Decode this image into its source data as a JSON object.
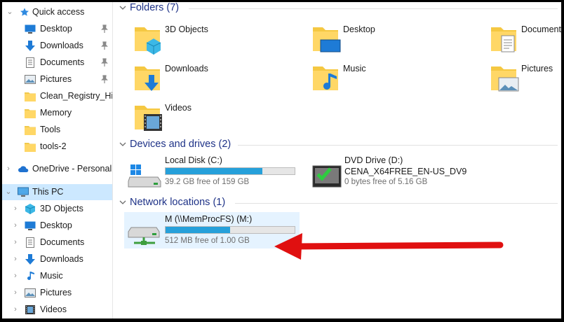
{
  "sidebar": {
    "quick_access": {
      "label": "Quick access",
      "items": [
        {
          "label": "Desktop",
          "pinned": true
        },
        {
          "label": "Downloads",
          "pinned": true
        },
        {
          "label": "Documents",
          "pinned": true
        },
        {
          "label": "Pictures",
          "pinned": true
        },
        {
          "label": "Clean_Registry_Hive",
          "pinned": false
        },
        {
          "label": "Memory",
          "pinned": false
        },
        {
          "label": "Tools",
          "pinned": false
        },
        {
          "label": "tools-2",
          "pinned": false
        }
      ]
    },
    "onedrive": {
      "label": "OneDrive - Personal"
    },
    "this_pc": {
      "label": "This PC",
      "items": [
        {
          "label": "3D Objects"
        },
        {
          "label": "Desktop"
        },
        {
          "label": "Documents"
        },
        {
          "label": "Downloads"
        },
        {
          "label": "Music"
        },
        {
          "label": "Pictures"
        },
        {
          "label": "Videos"
        }
      ]
    }
  },
  "main": {
    "folders": {
      "title": "Folders (7)",
      "items": [
        {
          "label": "3D Objects",
          "icon": "3d-objects-folder-icon"
        },
        {
          "label": "Desktop",
          "icon": "desktop-folder-icon"
        },
        {
          "label": "Documents",
          "icon": "documents-folder-icon"
        },
        {
          "label": "Downloads",
          "icon": "downloads-folder-icon"
        },
        {
          "label": "Music",
          "icon": "music-folder-icon"
        },
        {
          "label": "Pictures",
          "icon": "pictures-folder-icon"
        },
        {
          "label": "Videos",
          "icon": "videos-folder-icon"
        }
      ]
    },
    "devices": {
      "title": "Devices and drives (2)",
      "local_disk": {
        "name": "Local Disk (C:)",
        "free": "39.2 GB free of 159 GB",
        "used_fraction": 0.75
      },
      "dvd": {
        "name": "DVD Drive (D:)",
        "volume": "CENA_X64FREE_EN-US_DV9",
        "free": "0 bytes free of 5.16 GB"
      }
    },
    "network": {
      "title": "Network locations (1)",
      "drive": {
        "name": "M (\\\\MemProcFS) (M:)",
        "free": "512 MB free of 1.00 GB",
        "used_fraction": 0.5
      }
    }
  },
  "colors": {
    "accent": "#26a0da",
    "selection": "#cce8ff",
    "header_text": "#1e3287",
    "annotation_arrow": "#e01010"
  }
}
